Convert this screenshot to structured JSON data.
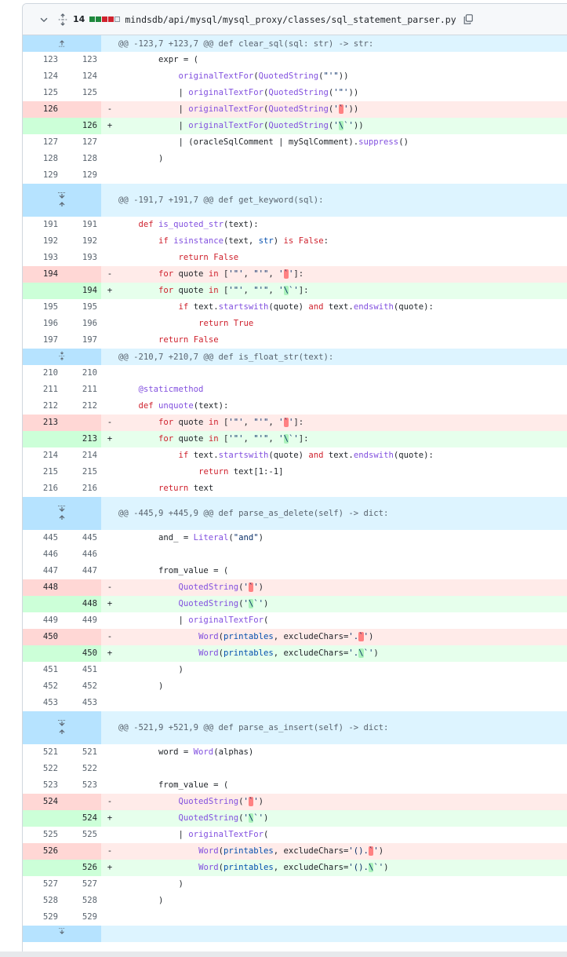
{
  "file": {
    "changes_count": "14",
    "path": "mindsdb/api/mysql/mysql_proxy/classes/sql_statement_parser.py",
    "diffstat": [
      "add",
      "add",
      "del",
      "del",
      "neutral"
    ],
    "colors": {
      "add": "#1f883d",
      "del": "#cf222e",
      "neutral": "#eaeef2"
    }
  },
  "hunks": [
    {
      "header": "@@ -123,7 +123,7 @@ def clear_sql(sql: str) -> str:",
      "expander": "up",
      "lines": [
        {
          "type": "ctx",
          "old": "123",
          "new": "123",
          "sign": "",
          "code": "        expr = ("
        },
        {
          "type": "ctx",
          "old": "124",
          "new": "124",
          "sign": "",
          "code": "            originalTextFor(QuotedString(\"'\"))"
        },
        {
          "type": "ctx",
          "old": "125",
          "new": "125",
          "sign": "",
          "code": "            | originalTextFor(QuotedString('\"'))"
        },
        {
          "type": "del",
          "old": "126",
          "new": "",
          "sign": "-",
          "code": "            | originalTextFor(QuotedString('`'))"
        },
        {
          "type": "add",
          "old": "",
          "new": "126",
          "sign": "+",
          "code": "            | originalTextFor(QuotedString('\\`'))"
        },
        {
          "type": "ctx",
          "old": "127",
          "new": "127",
          "sign": "",
          "code": "            | (oracleSqlComment | mySqlComment).suppress()"
        },
        {
          "type": "ctx",
          "old": "128",
          "new": "128",
          "sign": "",
          "code": "        )"
        },
        {
          "type": "ctx",
          "old": "129",
          "new": "129",
          "sign": "",
          "code": ""
        }
      ]
    },
    {
      "header": "@@ -191,7 +191,7 @@ def get_keyword(sql):",
      "expander": "both",
      "lines": [
        {
          "type": "ctx",
          "old": "191",
          "new": "191",
          "sign": "",
          "code": "    def is_quoted_str(text):"
        },
        {
          "type": "ctx",
          "old": "192",
          "new": "192",
          "sign": "",
          "code": "        if isinstance(text, str) is False:"
        },
        {
          "type": "ctx",
          "old": "193",
          "new": "193",
          "sign": "",
          "code": "            return False"
        },
        {
          "type": "del",
          "old": "194",
          "new": "",
          "sign": "-",
          "code": "        for quote in ['\"', \"'\", '`']:"
        },
        {
          "type": "add",
          "old": "",
          "new": "194",
          "sign": "+",
          "code": "        for quote in ['\"', \"'\", '\\`']:"
        },
        {
          "type": "ctx",
          "old": "195",
          "new": "195",
          "sign": "",
          "code": "            if text.startswith(quote) and text.endswith(quote):"
        },
        {
          "type": "ctx",
          "old": "196",
          "new": "196",
          "sign": "",
          "code": "                return True"
        },
        {
          "type": "ctx",
          "old": "197",
          "new": "197",
          "sign": "",
          "code": "        return False"
        }
      ]
    },
    {
      "header": "@@ -210,7 +210,7 @@ def is_float_str(text):",
      "expander": "collapse",
      "lines": [
        {
          "type": "ctx",
          "old": "210",
          "new": "210",
          "sign": "",
          "code": ""
        },
        {
          "type": "ctx",
          "old": "211",
          "new": "211",
          "sign": "",
          "code": "    @staticmethod"
        },
        {
          "type": "ctx",
          "old": "212",
          "new": "212",
          "sign": "",
          "code": "    def unquote(text):"
        },
        {
          "type": "del",
          "old": "213",
          "new": "",
          "sign": "-",
          "code": "        for quote in ['\"', \"'\", '`']:"
        },
        {
          "type": "add",
          "old": "",
          "new": "213",
          "sign": "+",
          "code": "        for quote in ['\"', \"'\", '\\`']:"
        },
        {
          "type": "ctx",
          "old": "214",
          "new": "214",
          "sign": "",
          "code": "            if text.startswith(quote) and text.endswith(quote):"
        },
        {
          "type": "ctx",
          "old": "215",
          "new": "215",
          "sign": "",
          "code": "                return text[1:-1]"
        },
        {
          "type": "ctx",
          "old": "216",
          "new": "216",
          "sign": "",
          "code": "        return text"
        }
      ]
    },
    {
      "header": "@@ -445,9 +445,9 @@ def parse_as_delete(self) -> dict:",
      "expander": "both",
      "lines": [
        {
          "type": "ctx",
          "old": "445",
          "new": "445",
          "sign": "",
          "code": "        and_ = Literal(\"and\")"
        },
        {
          "type": "ctx",
          "old": "446",
          "new": "446",
          "sign": "",
          "code": ""
        },
        {
          "type": "ctx",
          "old": "447",
          "new": "447",
          "sign": "",
          "code": "        from_value = ("
        },
        {
          "type": "del",
          "old": "448",
          "new": "",
          "sign": "-",
          "code": "            QuotedString('`')"
        },
        {
          "type": "add",
          "old": "",
          "new": "448",
          "sign": "+",
          "code": "            QuotedString('\\`')"
        },
        {
          "type": "ctx",
          "old": "449",
          "new": "449",
          "sign": "",
          "code": "            | originalTextFor("
        },
        {
          "type": "del",
          "old": "450",
          "new": "",
          "sign": "-",
          "code": "                Word(printables, excludeChars='.`')"
        },
        {
          "type": "add",
          "old": "",
          "new": "450",
          "sign": "+",
          "code": "                Word(printables, excludeChars='.\\`')"
        },
        {
          "type": "ctx",
          "old": "451",
          "new": "451",
          "sign": "",
          "code": "            )"
        },
        {
          "type": "ctx",
          "old": "452",
          "new": "452",
          "sign": "",
          "code": "        )"
        },
        {
          "type": "ctx",
          "old": "453",
          "new": "453",
          "sign": "",
          "code": ""
        }
      ]
    },
    {
      "header": "@@ -521,9 +521,9 @@ def parse_as_insert(self) -> dict:",
      "expander": "both",
      "lines": [
        {
          "type": "ctx",
          "old": "521",
          "new": "521",
          "sign": "",
          "code": "        word = Word(alphas)"
        },
        {
          "type": "ctx",
          "old": "522",
          "new": "522",
          "sign": "",
          "code": ""
        },
        {
          "type": "ctx",
          "old": "523",
          "new": "523",
          "sign": "",
          "code": "        from_value = ("
        },
        {
          "type": "del",
          "old": "524",
          "new": "",
          "sign": "-",
          "code": "            QuotedString('`')"
        },
        {
          "type": "add",
          "old": "",
          "new": "524",
          "sign": "+",
          "code": "            QuotedString('\\`')"
        },
        {
          "type": "ctx",
          "old": "525",
          "new": "525",
          "sign": "",
          "code": "            | originalTextFor("
        },
        {
          "type": "del",
          "old": "526",
          "new": "",
          "sign": "-",
          "code": "                Word(printables, excludeChars='().`')"
        },
        {
          "type": "add",
          "old": "",
          "new": "526",
          "sign": "+",
          "code": "                Word(printables, excludeChars='().\\`')"
        },
        {
          "type": "ctx",
          "old": "527",
          "new": "527",
          "sign": "",
          "code": "            )"
        },
        {
          "type": "ctx",
          "old": "528",
          "new": "528",
          "sign": "",
          "code": "        )"
        },
        {
          "type": "ctx",
          "old": "529",
          "new": "529",
          "sign": "",
          "code": ""
        }
      ]
    }
  ],
  "footer": {
    "expander": "down"
  }
}
